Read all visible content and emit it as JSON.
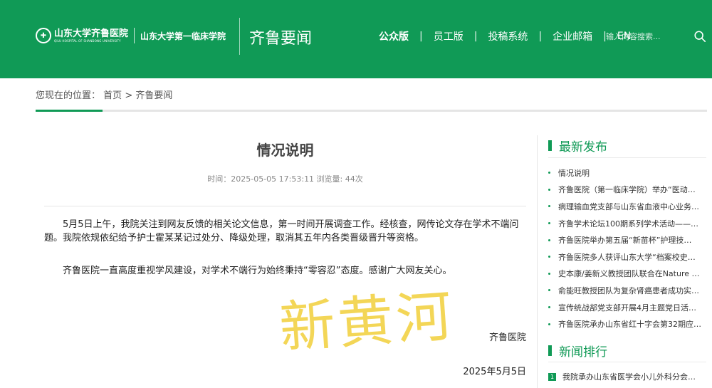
{
  "header": {
    "logo_main": "山东大学齐鲁医院",
    "logo_sub": "QILU HOSPITAL OF SHANDONG UNIVERSITY",
    "logo_secondary": "山东大学第一临床学院",
    "section_title": "齐鲁要闻",
    "nav": [
      "公众版",
      "员工版",
      "投稿系统",
      "企业邮箱",
      "EN"
    ],
    "nav_separator": "|",
    "search_placeholder": "输入内容搜索...",
    "color": "#109a56"
  },
  "breadcrumb": {
    "prefix": "您现在的位置：",
    "home": "首页",
    "separator": ">",
    "current": "齐鲁要闻"
  },
  "article": {
    "title": "情况说明",
    "meta": "时间：2025-05-05 17:53:11 浏览量: 44次",
    "paragraphs": [
      "5月5日上午，我院关注到网友反馈的相关论文信息，第一时间开展调查工作。经核查，网传论文存在学术不端问题。我院依规依纪给予护士霍某某记过处分、降级处理，取消其五年内各类晋级晋升等资格。",
      "齐鲁医院一直高度重视学风建设，对学术不端行为始终秉持“零容忍”态度。感谢广大网友关心。"
    ],
    "signature": "齐鲁医院",
    "date": "2025年5月5日",
    "watermark": "新黄河"
  },
  "sidebar": {
    "latest_title": "最新发布",
    "latest": [
      "情况说明",
      "齐鲁医院（第一临床学院）举办“医动…",
      "病理输血党支部与山东省血液中心业务…",
      "齐鲁学术论坛100期系列学术活动——…",
      "齐鲁医院举办第五届“新苗杯”护理技…",
      "齐鲁医院多人获评山东大学“档案校史…",
      "史本康/姜新义教授团队联合在Nature …",
      "俞能旺教授团队为复杂肾癌患者成功实…",
      "宣传统战部党支部开展4月主题党日活…",
      "齐鲁医院承办山东省红十字会第32期应…"
    ],
    "rank_title": "新闻排行",
    "rank": [
      {
        "num": "1",
        "title": "我院承办山东省医学会小儿外科分会…"
      }
    ]
  }
}
